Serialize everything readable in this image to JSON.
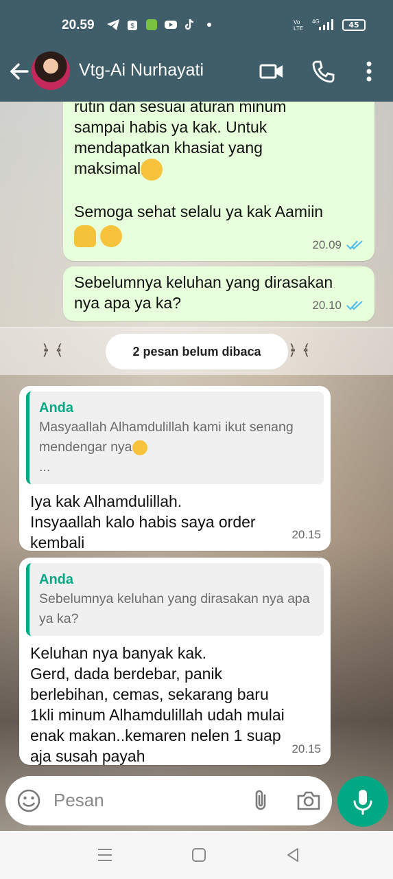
{
  "status_bar": {
    "time": "20.59",
    "network": "4G",
    "battery": "45"
  },
  "header": {
    "contact_name": "Vtg-Ai Nurhayati"
  },
  "messages": {
    "m1": {
      "partial_line": "rutin dan sesuai aturan minum",
      "text": "sampai habis  ya kak. Untuk\nmendapatkan khasiat yang\nmaksimal",
      "text2": "Semoga sehat selalu ya kak Aamiin",
      "time": "20.09"
    },
    "m2": {
      "text": "Sebelumnya keluhan yang dirasakan\nnya apa ya ka?",
      "time": "20.10"
    },
    "unread_banner": "2 pesan belum dibaca",
    "m3": {
      "quote_author": "Anda",
      "quote_text": "Masyaallah Alhamdulillah kami ikut senang mendengar nya",
      "quote_ellipsis": "...",
      "text": "Iya kak Alhamdulillah.\nInsyaallah kalo habis saya order\nkembali",
      "time": "20.15"
    },
    "m4": {
      "quote_author": "Anda",
      "quote_text": "Sebelumnya keluhan yang dirasakan nya apa ya ka?",
      "text": "Keluhan nya banyak kak.\nGerd, dada berdebar, panik\nberlebihan, cemas, sekarang baru\n1kli minum Alhamdulillah udah mulai\nenak makan..kemaren nelen 1 suap\naja susah payah",
      "time": "20.15"
    }
  },
  "input": {
    "placeholder": "Pesan"
  },
  "colors": {
    "header": "#3f5e6a",
    "outgoing": "#e7ffdb",
    "accent": "#00a884",
    "read_ticks": "#53bdeb"
  },
  "icons": {
    "back": "arrow-left-icon",
    "video": "video-call-icon",
    "phone": "phone-icon",
    "menu": "more-vert-icon",
    "emoji": "emoji-icon",
    "attach": "paperclip-icon",
    "camera": "camera-icon",
    "mic": "mic-icon"
  }
}
